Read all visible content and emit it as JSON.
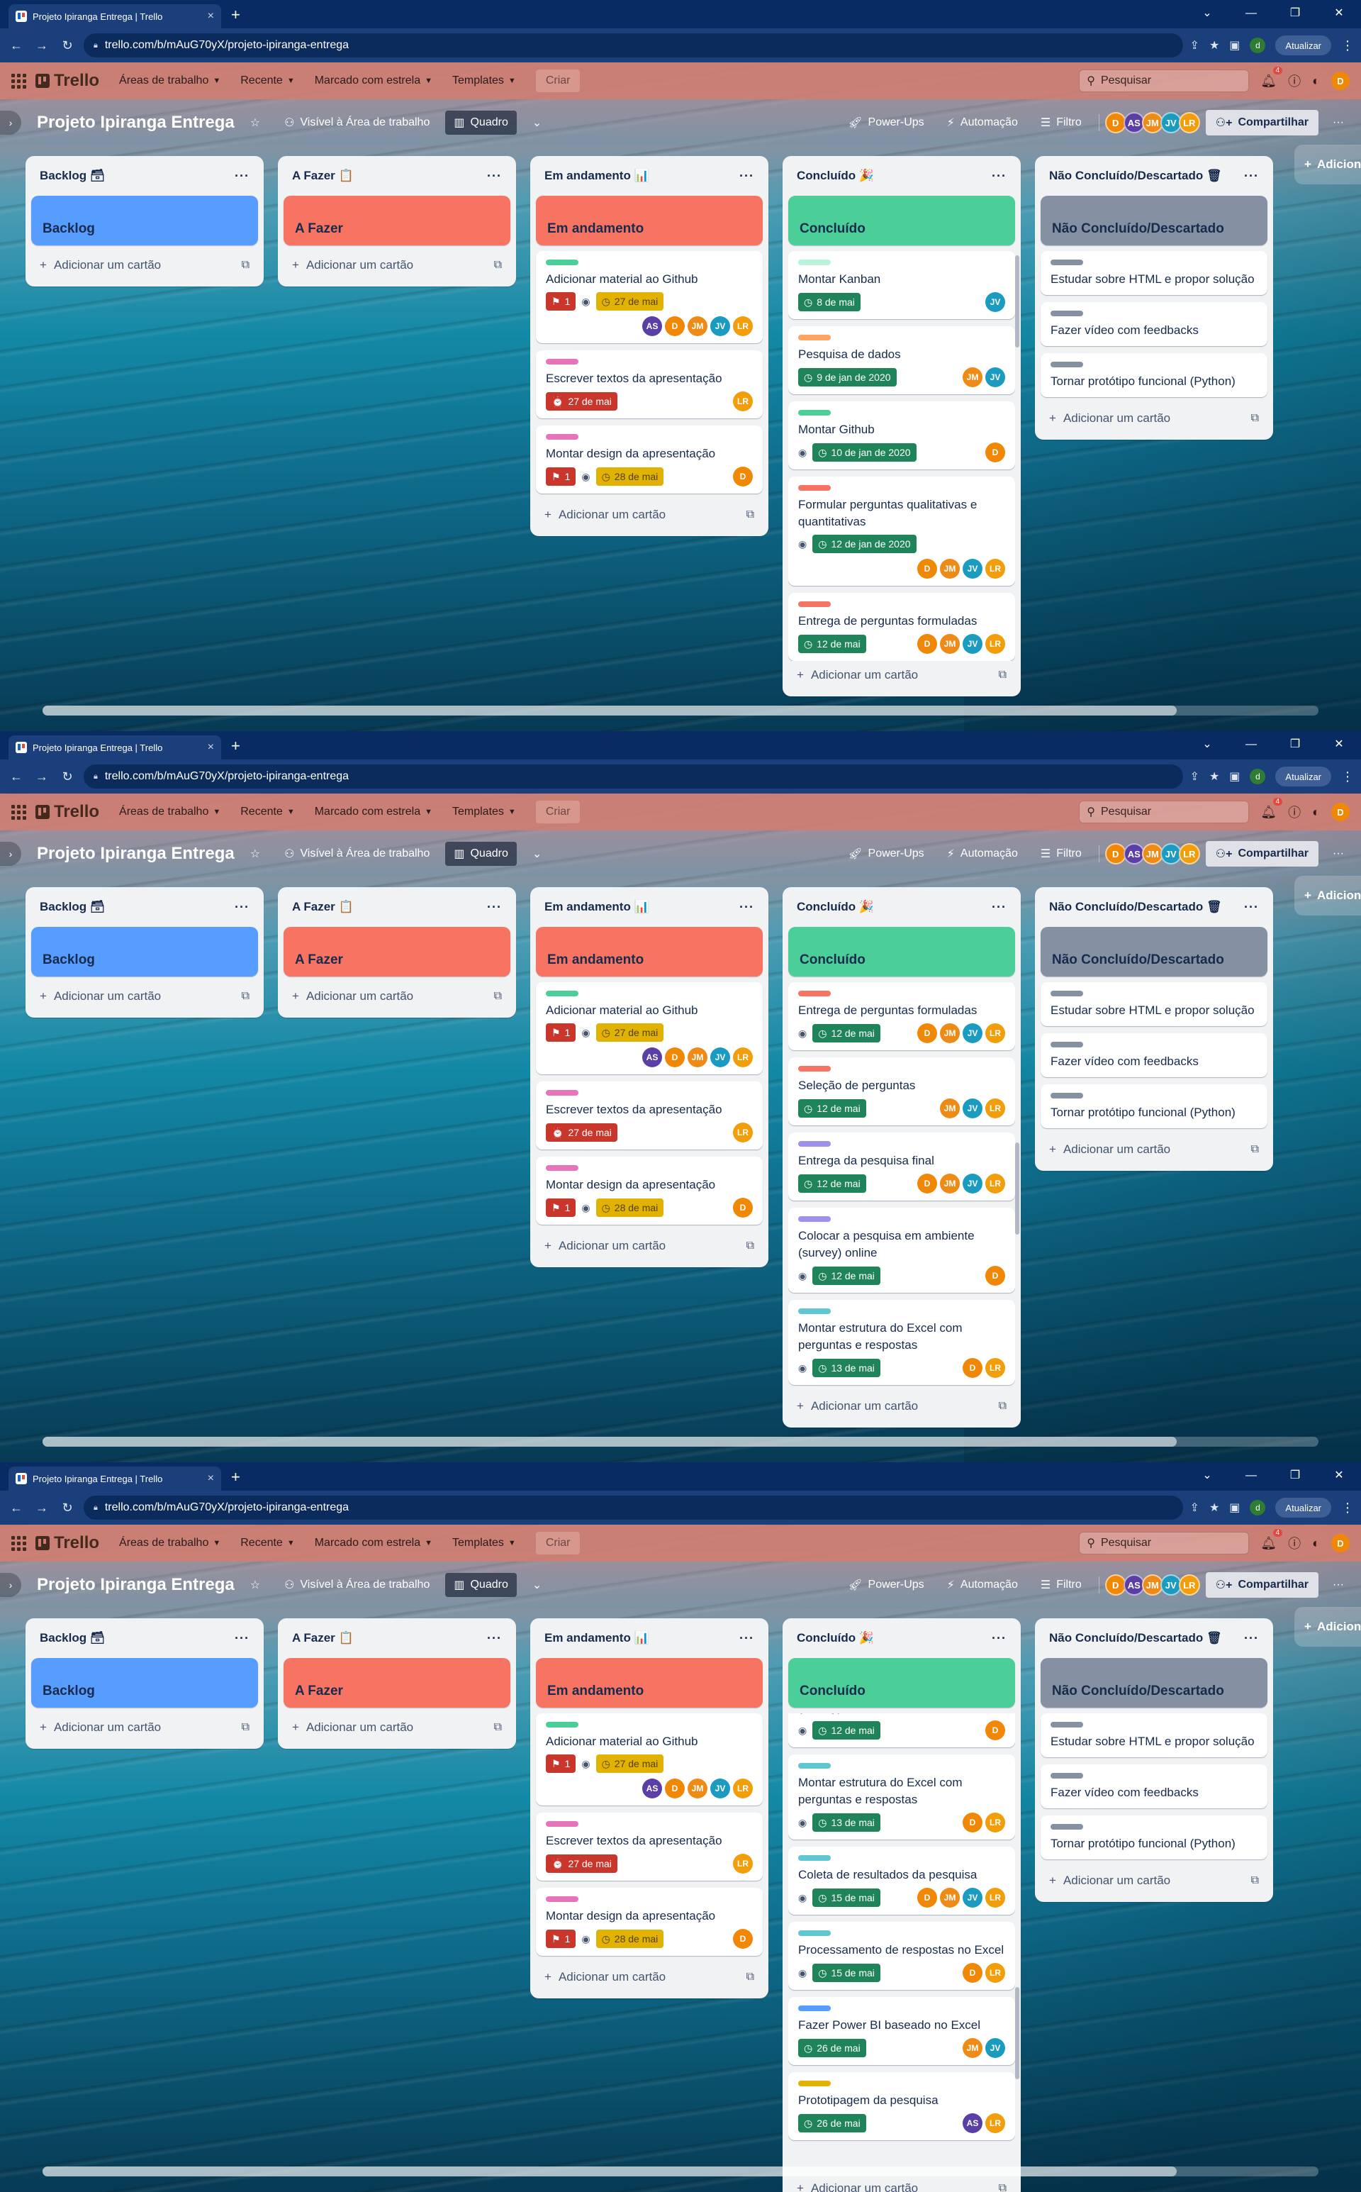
{
  "browser": {
    "tab_title": "Projeto Ipiranga Entrega | Trello",
    "url": "trello.com/b/mAuG70yX/projeto-ipiranga-entrega",
    "update_label": "Atualizar",
    "profile_initial": "d"
  },
  "trello": {
    "logo": "Trello",
    "menus": [
      "Áreas de trabalho",
      "Recente",
      "Marcado com estrela",
      "Templates"
    ],
    "create": "Criar",
    "search_placeholder": "Pesquisar",
    "notification_count": "4",
    "user_initial": "D"
  },
  "board": {
    "title": "Projeto Ipiranga Entrega",
    "visibility": "Visível à Área de trabalho",
    "view": "Quadro",
    "powerups": "Power-Ups",
    "automation": "Automação",
    "filter": "Filtro",
    "share": "Compartilhar",
    "members": [
      "D",
      "AS",
      "JM",
      "JV",
      "LR"
    ],
    "add_list_ghost": "Adicionar"
  },
  "colors": {
    "backlog": "#579dff",
    "afazer": "#f87462",
    "andamento": "#f87462",
    "concluido": "#4bce97",
    "descartado": "#8590a2",
    "lbl_green": "#4bce97",
    "lbl_pink": "#e774bb",
    "lbl_red": "#f87462",
    "lbl_orange": "#fea362",
    "lbl_mint": "#baf3db",
    "lbl_gray": "#8590a2",
    "lbl_purple": "#9f8fef",
    "lbl_teal": "#60c6d2",
    "lbl_blue": "#579dff",
    "lbl_yellow": "#e2b203"
  },
  "add_card": "Adicionar um cartão",
  "lists": {
    "backlog": {
      "name": "Backlog 🗃",
      "cover": "Backlog"
    },
    "afazer": {
      "name": "A Fazer 📋",
      "cover": "A Fazer"
    },
    "andamento": {
      "name": "Em andamento 📊",
      "cover": "Em andamento"
    },
    "concluido": {
      "name": "Concluído 🎉",
      "cover": "Concluído"
    },
    "descartado": {
      "name": "Não Concluído/Descartado 🗑",
      "cover": "Não Concluído/Descartado"
    }
  },
  "cards": {
    "a1": {
      "title": "Adicionar material ao Github",
      "count": "1",
      "date": "27 de mai"
    },
    "a2": {
      "title": "Escrever textos da apresentação",
      "date": "27 de mai"
    },
    "a3": {
      "title": "Montar design da apresentação",
      "count": "1",
      "date": "28 de mai"
    },
    "c1": {
      "title": "Montar Kanban",
      "date": "8 de mai"
    },
    "c2": {
      "title": "Pesquisa de dados",
      "date": "9 de jan de 2020"
    },
    "c3": {
      "title": "Montar Github",
      "date": "10 de jan de 2020"
    },
    "c4": {
      "title": "Formular perguntas qualitativas e quantitativas",
      "date": "12 de jan de 2020"
    },
    "c5": {
      "title": "Entrega de perguntas formuladas",
      "date": "12 de mai"
    },
    "c6": {
      "title": "Seleção de perguntas",
      "date": "12 de mai"
    },
    "c7": {
      "title": "Entrega da pesquisa final",
      "date": "12 de mai"
    },
    "c8": {
      "title": "Colocar a pesquisa em ambiente (survey) online",
      "title_tail": "(survey) online",
      "date": "12 de mai"
    },
    "c9": {
      "title": "Montar estrutura do Excel com perguntas e respostas",
      "date": "13 de mai"
    },
    "c10": {
      "title": "Coleta de resultados da pesquisa",
      "date": "15 de mai"
    },
    "c11": {
      "title": "Processamento de respostas no Excel",
      "date": "15 de mai"
    },
    "c12": {
      "title": "Fazer Power BI baseado no Excel",
      "date": "26 de mai"
    },
    "c13": {
      "title": "Prototipagem da pesquisa",
      "date": "26 de mai"
    },
    "d1": {
      "title": "Estudar sobre HTML e propor solução"
    },
    "d2": {
      "title": "Fazer vídeo com feedbacks"
    },
    "d3": {
      "title": "Tornar protótipo funcional (Python)"
    }
  }
}
